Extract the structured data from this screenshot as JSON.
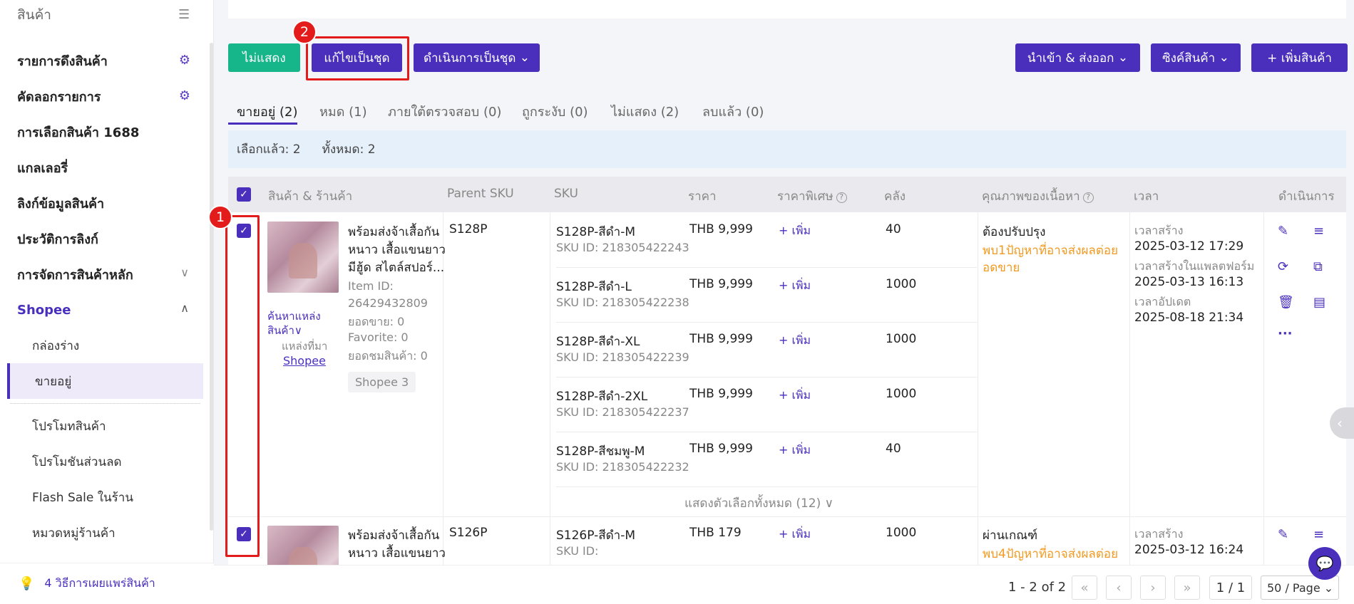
{
  "sidebar": {
    "top_label": "สินค้า",
    "items": [
      {
        "label": "รายการดึงสินค้า"
      },
      {
        "label": "คัดลอกรายการ"
      },
      {
        "label": "การเลือกสินค้า 1688"
      },
      {
        "label": "แกลเลอรี่"
      },
      {
        "label": "ลิงก์ข้อมูลสินค้า"
      },
      {
        "label": "ประวัติการลิงก์"
      },
      {
        "label": "การจัดการสินค้าหลัก"
      },
      {
        "label": "Shopee"
      }
    ],
    "sub_items": [
      {
        "label": "กล่องร่าง"
      },
      {
        "label": "ขายอยู่"
      },
      {
        "label": "โปรโมทสินค้า"
      },
      {
        "label": "โปรโมชันส่วนลด"
      },
      {
        "label": "Flash Sale ในร้าน"
      },
      {
        "label": "หมวดหมู่ร้านค้า"
      }
    ],
    "footer": "4 วิธีการเผยแพร่สินค้า"
  },
  "toolbar": {
    "hide": "ไม่แสดง",
    "bulk_edit": "แก้ไขเป็นชุด",
    "bulk_action": "ดำเนินการเป็นชุด",
    "import_export": "นำเข้า & ส่งออก",
    "sync": "ซิงค์สินค้า",
    "add": "+ เพิ่มสินค้า"
  },
  "callouts": {
    "one": "1",
    "two": "2"
  },
  "tabs": [
    {
      "label": "ขายอยู่ (2)"
    },
    {
      "label": "หมด (1)"
    },
    {
      "label": "ภายใต้ตรวจสอบ (0)"
    },
    {
      "label": "ถูกระงับ (0)"
    },
    {
      "label": "ไม่แสดง (2)"
    },
    {
      "label": "ลบแล้ว (0)"
    }
  ],
  "selection": {
    "selected": "เลือกแล้ว: 2",
    "total": "ทั้งหมด: 2"
  },
  "columns": {
    "product": "สินค้า & ร้านค้า",
    "parent_sku": "Parent SKU",
    "sku": "SKU",
    "price": "ราคา",
    "special_price": "ราคาพิเศษ",
    "stock": "คลัง",
    "quality": "คุณภาพของเนื้อหา",
    "time": "เวลา",
    "actions": "ดำเนินการ"
  },
  "rows": [
    {
      "title_l1": "พร้อมส่งจ้าเสื้อกัน",
      "title_l2": "หนาว เสื้อแขนยาว",
      "title_l3": "มีฮู้ด สไตล์สปอร์...",
      "item_id_label": "Item ID:",
      "item_id": "26429432809",
      "sales": "ยอดขาย: 0",
      "favorite": "Favorite: 0",
      "views": "ยอดชมสินค้า: 0",
      "find_source_l1": "ค้นหาแหล่ง",
      "find_source_l2": "สินค้า∨",
      "source_label": "แหล่งที่มา",
      "source": "Shopee",
      "store_tag": "Shopee 3",
      "parent_sku": "S128P",
      "variants": [
        {
          "sku": "S128P-สีดำ-M",
          "sku_id": "SKU ID: 218305422243",
          "price": "THB 9,999",
          "special": "+ เพิ่ม",
          "stock": "40"
        },
        {
          "sku": "S128P-สีดำ-L",
          "sku_id": "SKU ID: 218305422238",
          "price": "THB 9,999",
          "special": "+ เพิ่ม",
          "stock": "1000"
        },
        {
          "sku": "S128P-สีดำ-XL",
          "sku_id": "SKU ID: 218305422239",
          "price": "THB 9,999",
          "special": "+ เพิ่ม",
          "stock": "1000"
        },
        {
          "sku": "S128P-สีดำ-2XL",
          "sku_id": "SKU ID: 218305422237",
          "price": "THB 9,999",
          "special": "+ เพิ่ม",
          "stock": "1000"
        },
        {
          "sku": "S128P-สีชมพู-M",
          "sku_id": "SKU ID: 218305422232",
          "price": "THB 9,999",
          "special": "+ เพิ่ม",
          "stock": "40"
        }
      ],
      "show_all": "แสดงตัวเลือกทั้งหมด  (12) ∨",
      "quality": "ต้องปรับปรุง",
      "issue_l1": "พบ1ปัญหาที่อาจส่งผลต่อย",
      "issue_l2": "อดขาย",
      "created_label": "เวลาสร้าง",
      "created": "2025-03-12 17:29",
      "platform_label": "เวลาสร้างในแพลตฟอร์ม",
      "platform": "2025-03-13 16:13",
      "updated_label": "เวลาอัปเดต",
      "updated": "2025-08-18 21:34"
    },
    {
      "title_l1": "พร้อมส่งจ้าเสื้อกัน",
      "title_l2": "หนาว เสื้อแขนยาว",
      "parent_sku": "S126P",
      "sku": "S126P-สีดำ-M",
      "sku_id": "SKU ID:",
      "price": "THB 179",
      "special": "+ เพิ่ม",
      "stock": "1000",
      "quality": "ผ่านเกณฑ์",
      "issue_l1": "พบ4ปัญหาที่อาจส่งผลต่อย",
      "created_label": "เวลาสร้าง",
      "created": "2025-03-12 16:24"
    }
  ],
  "pagination": {
    "range": "1 - 2 of 2",
    "page": "1 / 1",
    "page_size": "50 / Page"
  },
  "colors": {
    "primary": "#4a2fbd",
    "green": "#17b68a",
    "callout": "#e31b1b",
    "warning": "#f29a21"
  }
}
